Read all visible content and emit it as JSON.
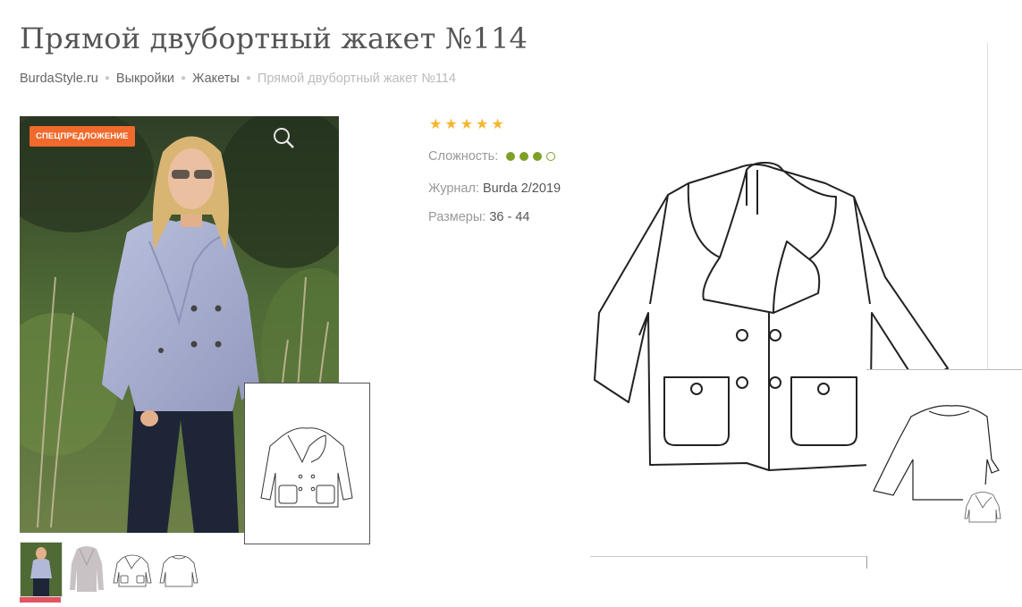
{
  "title": "Прямой двубортный жакет №114",
  "breadcrumb": {
    "items": [
      "BurdaStyle.ru",
      "Выкройки",
      "Жакеты"
    ],
    "current": "Прямой двубортный жакет №114"
  },
  "photo": {
    "badge": "СПЕЦПРЕДЛОЖЕНИЕ"
  },
  "rating": {
    "stars": 5
  },
  "info": {
    "difficulty_label": "Сложность:",
    "difficulty_level": 3,
    "difficulty_max": 4,
    "journal_label": "Журнал:",
    "journal_value": "Burda 2/2019",
    "sizes_label": "Размеры:",
    "sizes_value": "36 - 44"
  },
  "colors": {
    "accent": "#ef6a2c",
    "star": "#f3b72e",
    "difficulty": "#7fa027",
    "active_thumb": "#e25361"
  }
}
